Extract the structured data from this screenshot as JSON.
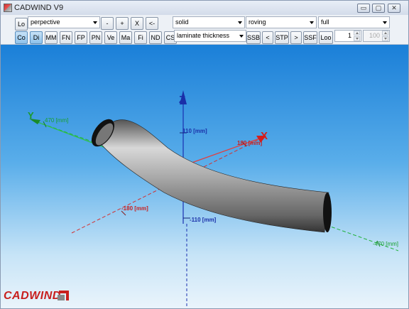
{
  "window": {
    "title": "CADWIND V9",
    "controls": {
      "minimize": "▭",
      "maximize": "▢",
      "close": "✕"
    }
  },
  "toolbar": {
    "row1": {
      "lo_label": "Lo",
      "view_mode": "perpective",
      "minus_label": "-",
      "plus_label": "+",
      "x_label": "X",
      "back_label": "<-",
      "render_mode": "solid",
      "material_mode": "roving",
      "coverage_mode": "full"
    },
    "row2": {
      "buttons": [
        "Co",
        "Di",
        "MM",
        "FN",
        "FP",
        "PN",
        "Ve",
        "Ma",
        "Fi",
        "ND",
        "CS"
      ],
      "display_mode": "laminate thickness",
      "ssb_label": "SSB",
      "prev_label": "<",
      "stp_label": "STP",
      "next_label": ">",
      "ssf_label": "SSF",
      "loo_label": "Loo",
      "step_value": "1",
      "step_max": "100"
    }
  },
  "viewport": {
    "axis_labels": {
      "z": "Z",
      "x": "X",
      "y": "Y"
    },
    "dimensions": {
      "y_pos": "470 [mm]",
      "z_pos": "110 [mm]",
      "x_pos": "180 [mm]",
      "x_neg": "-180 [mm]",
      "z_neg": "-110 [mm]",
      "y_neg": "-470 [mm]"
    },
    "colors": {
      "x_axis": "#d41e1e",
      "y_axis": "#1a9a2a",
      "z_axis": "#1a2fa8",
      "background_top": "#1a7fd8",
      "background_bottom": "#eaf4fb"
    }
  },
  "branding": {
    "logo_text": "CADWIND"
  }
}
